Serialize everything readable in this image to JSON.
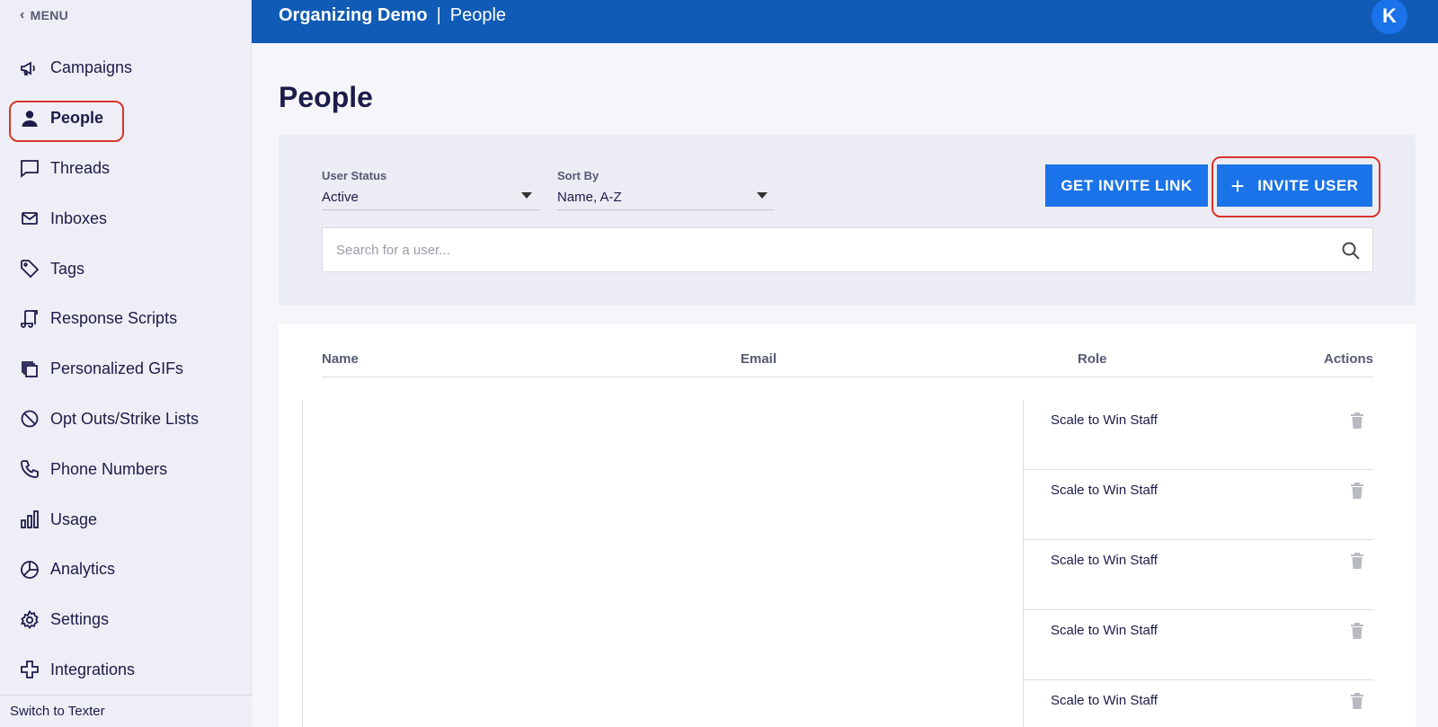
{
  "sidebar": {
    "menu_label": "MENU",
    "items": [
      {
        "label": "Campaigns",
        "icon": "megaphone-icon"
      },
      {
        "label": "People",
        "icon": "person-icon",
        "active": true
      },
      {
        "label": "Threads",
        "icon": "chat-bubble-icon"
      },
      {
        "label": "Inboxes",
        "icon": "envelope-icon"
      },
      {
        "label": "Tags",
        "icon": "tag-icon"
      },
      {
        "label": "Response Scripts",
        "icon": "script-icon"
      },
      {
        "label": "Personalized GIFs",
        "icon": "copy-icon"
      },
      {
        "label": "Opt Outs/Strike Lists",
        "icon": "block-icon"
      },
      {
        "label": "Phone Numbers",
        "icon": "phone-icon"
      },
      {
        "label": "Usage",
        "icon": "bar-chart-icon"
      },
      {
        "label": "Analytics",
        "icon": "pie-chart-icon"
      },
      {
        "label": "Settings",
        "icon": "gear-icon"
      },
      {
        "label": "Integrations",
        "icon": "puzzle-icon"
      }
    ],
    "switch_label": "Switch to Texter"
  },
  "header": {
    "org": "Organizing Demo",
    "separator": "|",
    "section": "People",
    "avatar_initial": "K"
  },
  "page": {
    "title": "People"
  },
  "filters": {
    "user_status_label": "User Status",
    "user_status_value": "Active",
    "sort_by_label": "Sort By",
    "sort_by_value": "Name, A-Z",
    "get_invite_link": "GET INVITE LINK",
    "invite_user": "INVITE USER",
    "search_placeholder": "Search for a user..."
  },
  "table": {
    "columns": {
      "name": "Name",
      "email": "Email",
      "role": "Role",
      "actions": "Actions"
    },
    "rows": [
      {
        "role": "Scale to Win Staff"
      },
      {
        "role": "Scale to Win Staff"
      },
      {
        "role": "Scale to Win Staff"
      },
      {
        "role": "Scale to Win Staff"
      },
      {
        "role": "Scale to Win Staff"
      }
    ]
  },
  "colors": {
    "header_blue": "#0f5bb5",
    "button_blue": "#1a73e8",
    "highlight_red": "#d9342b",
    "sidebar_bg": "#eeeef6"
  }
}
